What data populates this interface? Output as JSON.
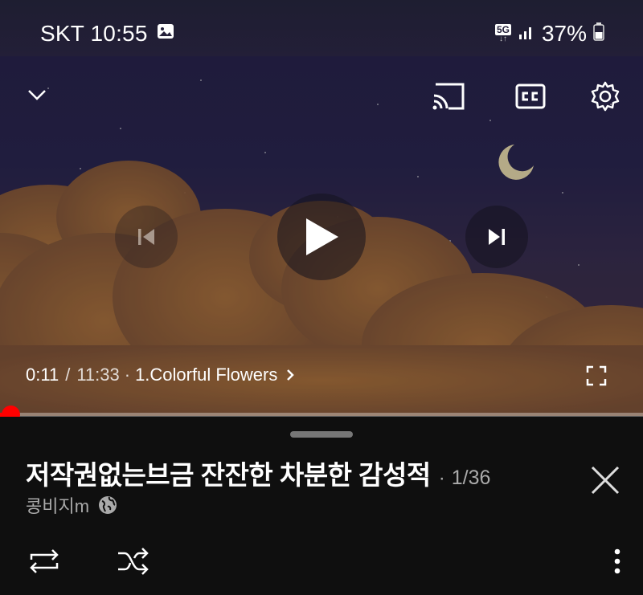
{
  "status_bar": {
    "carrier_time": "SKT 10:55",
    "network": "5G",
    "battery": "37%",
    "icons": [
      "gallery-notification-icon",
      "network-5g-icon",
      "signal-icon",
      "battery-icon"
    ]
  },
  "player": {
    "current_time": "0:11",
    "separator": "/",
    "duration": "11:33",
    "chapter_bullet": "·",
    "chapter": "1.Colorful Flowers",
    "progress_fraction": 0.016,
    "icons": [
      "minimize-chevron-icon",
      "cast-icon",
      "captions-icon",
      "settings-gear-icon",
      "previous-icon",
      "play-icon",
      "next-icon",
      "fullscreen-icon",
      "chapter-chevron-icon"
    ]
  },
  "playlist": {
    "title": "저작권없는브금 잔잔한 차분한 감성적",
    "bullet": "·",
    "position": "1/36",
    "channel": "콩비지m",
    "icons": [
      "globe-icon",
      "close-icon",
      "loop-icon",
      "shuffle-icon",
      "more-vert-icon"
    ]
  },
  "colors": {
    "accent": "#ff0000",
    "background": "#0f0f0f",
    "muted_text": "#aaaaaa"
  }
}
